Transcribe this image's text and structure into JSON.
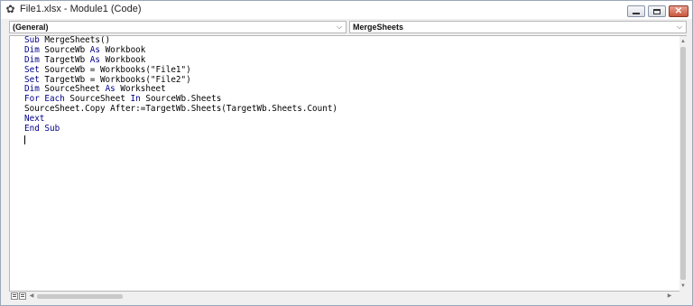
{
  "window": {
    "title": "File1.xlsx - Module1 (Code)",
    "icons": {
      "app": "vba-module-icon",
      "minimize": "minimize-icon",
      "maximize": "maximize-icon",
      "close": "close-icon"
    }
  },
  "object_combo": {
    "value": "(General)"
  },
  "procedure_combo": {
    "value": "MergeSheets"
  },
  "code": {
    "lines": [
      [
        {
          "t": "Sub",
          "k": true
        },
        {
          "t": " MergeSheets()"
        }
      ],
      [
        {
          "t": "Dim",
          "k": true
        },
        {
          "t": " SourceWb "
        },
        {
          "t": "As",
          "k": true
        },
        {
          "t": " Workbook"
        }
      ],
      [
        {
          "t": "Dim",
          "k": true
        },
        {
          "t": " TargetWb "
        },
        {
          "t": "As",
          "k": true
        },
        {
          "t": " Workbook"
        }
      ],
      [
        {
          "t": "Set",
          "k": true
        },
        {
          "t": " SourceWb = Workbooks(\"File1\")"
        }
      ],
      [
        {
          "t": "Set",
          "k": true
        },
        {
          "t": " TargetWb = Workbooks(\"File2\")"
        }
      ],
      [
        {
          "t": "Dim",
          "k": true
        },
        {
          "t": " SourceSheet "
        },
        {
          "t": "As",
          "k": true
        },
        {
          "t": " Worksheet"
        }
      ],
      [
        {
          "t": "For Each",
          "k": true
        },
        {
          "t": " SourceSheet "
        },
        {
          "t": "In",
          "k": true
        },
        {
          "t": " SourceWb.Sheets"
        }
      ],
      [
        {
          "t": "SourceSheet.Copy After:=TargetWb.Sheets(TargetWb.Sheets.Count)"
        }
      ],
      [
        {
          "t": "Next",
          "k": true
        }
      ],
      [
        {
          "t": "End Sub",
          "k": true
        }
      ]
    ],
    "keyword_color": "#00008b",
    "text_color": "#000000"
  },
  "colors": {
    "editor_background": "#ffffff",
    "chrome": "#f0f0f0",
    "close_button": "#c9573d"
  }
}
